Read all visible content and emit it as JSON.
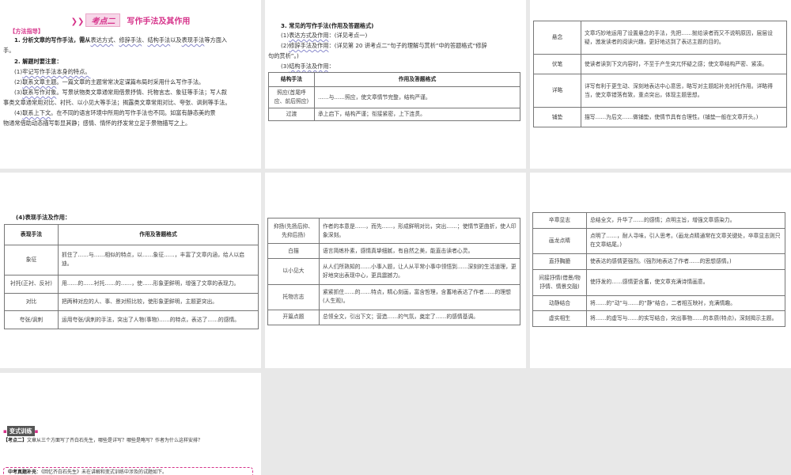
{
  "colors": {
    "accent": "#d6338a",
    "gap": "#e8e8e8"
  },
  "panel1": {
    "title_tag": "考点二",
    "title": "写作手法及其作用",
    "method": "【方法指导】",
    "l1_pre": "1. 分析文章的写作手法，需从",
    "l1_u1": "表达方式",
    "l1_s1": "、",
    "l1_u2": "修辞手法",
    "l1_s2": "、",
    "l1_u3": "结构手法",
    "l1_s3": "以及",
    "l1_u4": "表现手法",
    "l1_post": "等方面入",
    "l1b": "手。",
    "l2": "2. 解题时要注意：",
    "i1": "(1)",
    "i1u": "牢记写作手法本身的特点。",
    "i2": "(2)",
    "i2u": "联系文章主题",
    "i2t": "。一篇文章的主题常常决定谋篇布局时采用什么写作手法。",
    "i3": "(3)",
    "i3u": "联系写作对象",
    "i3t": "。写景状物类文章通常用借景抒情、托物言志、象征等手法；写人叙",
    "i3b": "事类文章通常用对比、衬托、以小见大等手法；揭露类文章常用对比、夸张、讽刺等手法。",
    "i4": "(4)",
    "i4u": "联系上下文",
    "i4t": "。在不同的语言环境中所用的写作手法也不同。如富有静态美的景",
    "i4b": "物通常借助动态描写彰显其静；感情、情怀的抒发常立足于景物描写之上。"
  },
  "panel2": {
    "heading": "3. 常见的写作手法(作用及答题格式)",
    "s1": "(1)",
    "s1u": "表达方式及作用",
    "s1t": "：(详见考点一)",
    "s2": "(2)",
    "s2u": "修辞手法及作用",
    "s2t": "：(详见第 20 讲考点二“句子的理解与赏析”中的答题格式“修辞",
    "s2b": "句的赏析”。)",
    "s3": "(3)",
    "s3u": "结构手法及作用",
    "s3t": "：",
    "headers": [
      "结构手法",
      "作用及答题格式"
    ],
    "rows": [
      [
        "照应(首尾呼应、前后照应)",
        "……与……照应，使文章情节完整，结构严谨。"
      ],
      [
        "过渡",
        "承上启下，结构严谨；衔接紧密，上下连贯。"
      ]
    ]
  },
  "panel3": {
    "rows": [
      [
        "悬念",
        "文章巧妙地运用了设置悬念的手法，先把……抛给读者而又不说明原因，层层设疑，激发读者的阅读兴趣，更好地达到了表达主题的目的。"
      ],
      [
        "伏笔",
        "使读者读到下文内容时，不至于产生突兀怀疑之感；使文章结构严密、紧凑。"
      ],
      [
        "详略",
        "详写有利于更生动、深刻地表达中心意思，略写对主题起补充衬托作用。详略得当，使文章错落有致，重点突出，体现主题思想。"
      ],
      [
        "铺垫",
        "描写……为后文……做铺垫，使情节具有合理性。(铺垫一般在文章开头。)"
      ]
    ]
  },
  "panel4": {
    "heading": "(4)表现手法及作用：",
    "headers": [
      "表现手法",
      "作用及答题格式"
    ],
    "rows": [
      [
        "象征",
        "抓住了……与……相似的特点，以……象征……，丰富了文章内涵，给人以启迪。"
      ],
      [
        "衬托(正衬、反衬)",
        "用……的……衬托……的……，使……形象更鲜明，增强了文章的表现力。"
      ],
      [
        "对比",
        "把两种对应的人、事、景对照比较，使形象更鲜明，主题更突出。"
      ],
      [
        "夸张/讽刺",
        "运用夸张/讽刺的手法，突出了人物(事物)……的特点，表达了……的感情。"
      ]
    ]
  },
  "panel5": {
    "rows": [
      [
        "抑扬(先扬后抑、先抑后扬)",
        "作者的本意是……，而先……，形成鲜明对比，突出……；使情节更曲折，使人印象深刻。"
      ],
      [
        "白描",
        "语言简练朴素，感情真挚细腻，有自然之美，能直击读者心灵。"
      ],
      [
        "以小见大",
        "从人们所熟知的……小事入题，让人从平常小事中领悟到……深刻的生活道理，更好地突出表现中心，更具震撼力。"
      ],
      [
        "托物言志",
        "紧紧抓住……的……特点，精心刻画，富含哲理，含蓄地表达了作者……的理想(人生观)。"
      ],
      [
        "开篇点题",
        "总领全文，引出下文；营造……的气氛，奠定了……的感情基调。"
      ]
    ]
  },
  "panel6": {
    "rows": [
      [
        "卒章显志",
        "总结全文，升华了……的感情；点明主旨，增强文章感染力。"
      ],
      [
        "画龙点睛",
        "点明了……，耐人寻味，引人思考。(画龙点睛通常在文章关键处，卒章显志则只在文章结尾。)"
      ],
      [
        "直抒胸臆",
        "使表达的感情更强烈。(强烈地表达了作者……的思想感情。)"
      ],
      [
        "间接抒情(借景/物抒情、情景交融)",
        "使抒发的……感情更含蓄，使文章充满诗情画意。"
      ],
      [
        "动静结合",
        "将……的“动”与……的“静”结合，二者相互映衬，充满情趣。"
      ],
      [
        "虚实相生",
        "将……的虚写与……的实写结合，突出事物……的本质(特点)，深刻揭示主题。"
      ]
    ]
  },
  "panel7": {
    "badge": "变式训练",
    "q_tag": "【考点二】",
    "question": "文章从三个方面写了齐白石先生，哪些是详写？哪些是略写？作者为什么这样安排？",
    "note_tag": "中考真题补充",
    "note": "：《回忆齐白石先生》未在讲解和变式训练中涉及的试题如下。"
  }
}
